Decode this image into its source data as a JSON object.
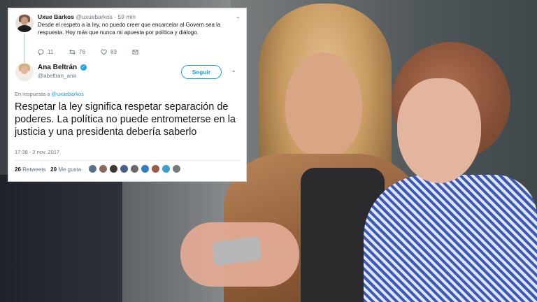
{
  "reply_tweet": {
    "name": "Uxue Barkos",
    "handle": "@uxuebarkos",
    "time": "59 min",
    "text": "Desde el respeto a la ley, no puedo creer que encarcelar al Govern sea la respuesta. Hoy más que nunca mi apuesta por política y diálogo.",
    "replies": "11",
    "retweets": "76",
    "likes": "83"
  },
  "main_tweet": {
    "name": "Ana Beltrán",
    "handle": "@abeltran_ana",
    "follow_label": "Seguir",
    "in_reply_prefix": "En respuesta a",
    "in_reply_handle": "@uxuebarkos",
    "text": "Respetar la ley significa respetar  separación de poderes. La política no puede entrometerse en la justicia y una presidenta debería saberlo",
    "timestamp": "17:38 - 2 nov. 2017",
    "retweets_count": "26",
    "retweets_label": "Retweets",
    "likes_count": "20",
    "likes_label": "Me gusta"
  },
  "icons": [
    "reply-icon",
    "retweet-icon",
    "heart-icon",
    "dm-icon",
    "chevron-down-icon",
    "verified-icon"
  ],
  "colors": {
    "twitter_blue": "#1da1f2",
    "text": "#14171a",
    "muted": "#657786"
  },
  "likers": [
    "#5b6f8a",
    "#8a6a5a",
    "#3a3a3a",
    "#4a5f8c",
    "#6a6a6a",
    "#2f7fbf",
    "#9c5a4a",
    "#3aa0d0",
    "#7a7a7a"
  ]
}
